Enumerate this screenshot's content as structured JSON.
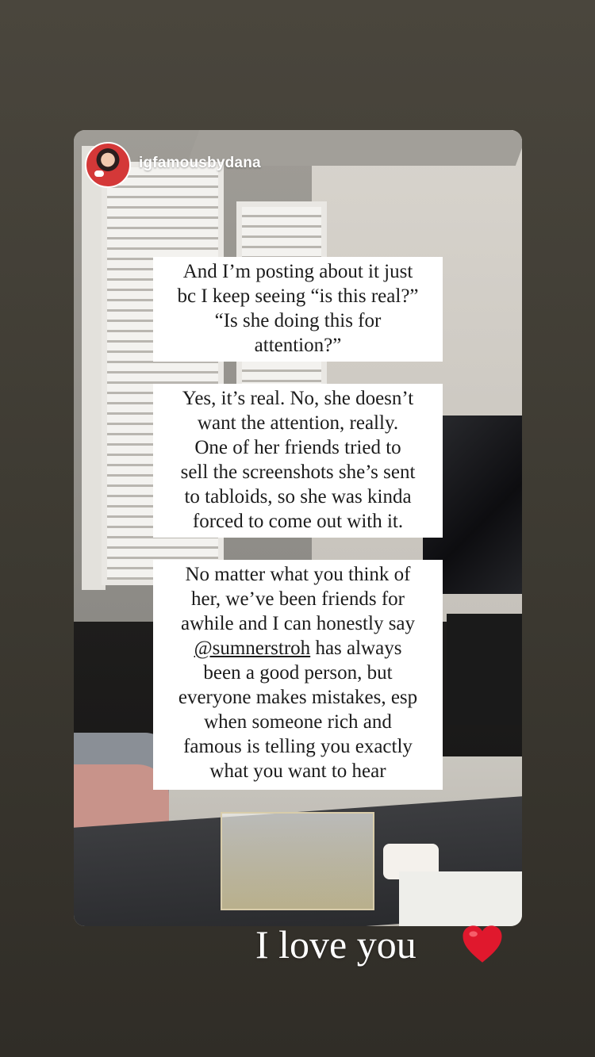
{
  "story": {
    "username": "igfamousbydana",
    "blocks": [
      {
        "lines": [
          "And I’m posting about it just",
          "bc I keep seeing “is this real?”",
          "“Is she doing this for",
          "attention?”"
        ]
      },
      {
        "lines": [
          "Yes, it’s real. No, she doesn’t",
          "want the attention, really.",
          "One of her friends tried to",
          "sell the screenshots she’s sent",
          "to tabloids, so she was kinda",
          "forced to come out with it."
        ]
      },
      {
        "lines": [
          "No matter what you think of",
          "her, we’ve been friends for",
          "awhile and I can honestly say",
          "has always",
          "been a good person, but",
          "everyone makes mistakes, esp",
          "when someone rich and",
          "famous is telling you exactly",
          "what you want to hear"
        ],
        "mention": "@sumnerstroh"
      }
    ],
    "caption": "I love you",
    "caption_icon": "red-heart-icon",
    "accent_color": "#e0182d"
  }
}
